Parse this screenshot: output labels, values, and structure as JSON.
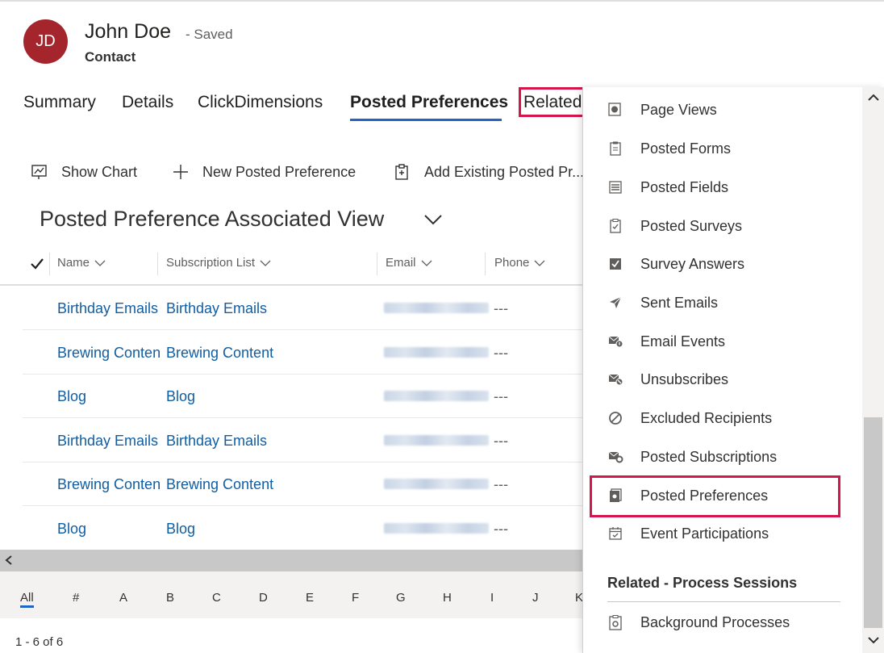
{
  "record": {
    "initials": "JD",
    "name": "John Doe",
    "saved_status": "- Saved",
    "entity": "Contact"
  },
  "tabs": [
    {
      "label": "Summary"
    },
    {
      "label": "Details"
    },
    {
      "label": "ClickDimensions"
    },
    {
      "label": "Posted Preferences",
      "active": true
    },
    {
      "label": "Related"
    }
  ],
  "commands": {
    "show_chart": "Show Chart",
    "new": "New Posted Preference",
    "add_existing": "Add Existing Posted Pr..."
  },
  "view": {
    "title": "Posted Preference Associated View"
  },
  "grid": {
    "columns": [
      "Name",
      "Subscription List",
      "Email",
      "Phone"
    ],
    "rows": [
      {
        "name": "Birthday Emails",
        "subscription_list": "Birthday Emails",
        "email": "(redacted)",
        "phone": "---"
      },
      {
        "name": "Brewing Content",
        "subscription_list": "Brewing Content",
        "email": "(redacted)",
        "phone": "---"
      },
      {
        "name": "Blog",
        "subscription_list": "Blog",
        "email": "(redacted)",
        "phone": "---"
      },
      {
        "name": "Birthday Emails",
        "subscription_list": "Birthday Emails",
        "email": "(redacted)",
        "phone": "---"
      },
      {
        "name": "Brewing Content",
        "subscription_list": "Brewing Content",
        "email": "(redacted)",
        "phone": "---"
      },
      {
        "name": "Blog",
        "subscription_list": "Blog",
        "email": "(redacted)",
        "phone": "---"
      }
    ]
  },
  "jumpbar": [
    "All",
    "#",
    "A",
    "B",
    "C",
    "D",
    "E",
    "F",
    "G",
    "H",
    "I",
    "J",
    "K"
  ],
  "record_count": "1 - 6 of 6",
  "related_menu": {
    "items": [
      {
        "label": "Page Views",
        "icon": "globe-page-icon"
      },
      {
        "label": "Posted Forms",
        "icon": "clipboard-icon"
      },
      {
        "label": "Posted Fields",
        "icon": "list-icon"
      },
      {
        "label": "Posted Surveys",
        "icon": "survey-check-icon"
      },
      {
        "label": "Survey Answers",
        "icon": "checkbox-icon"
      },
      {
        "label": "Sent Emails",
        "icon": "send-icon"
      },
      {
        "label": "Email Events",
        "icon": "mail-info-icon"
      },
      {
        "label": "Unsubscribes",
        "icon": "mail-block-icon"
      },
      {
        "label": "Excluded Recipients",
        "icon": "blocked-icon"
      },
      {
        "label": "Posted Subscriptions",
        "icon": "mail-gear-icon"
      },
      {
        "label": "Posted Preferences",
        "icon": "gear-page-icon",
        "highlighted": true
      },
      {
        "label": "Event Participations",
        "icon": "calendar-check-icon"
      }
    ],
    "section_title": "Related - Process Sessions",
    "section_items": [
      {
        "label": "Background Processes",
        "icon": "clipboard-gear-icon"
      }
    ]
  },
  "colors": {
    "accent": "#2266c5",
    "highlight": "#d6154a",
    "link": "#115ea3",
    "avatar": "#a4262c"
  }
}
